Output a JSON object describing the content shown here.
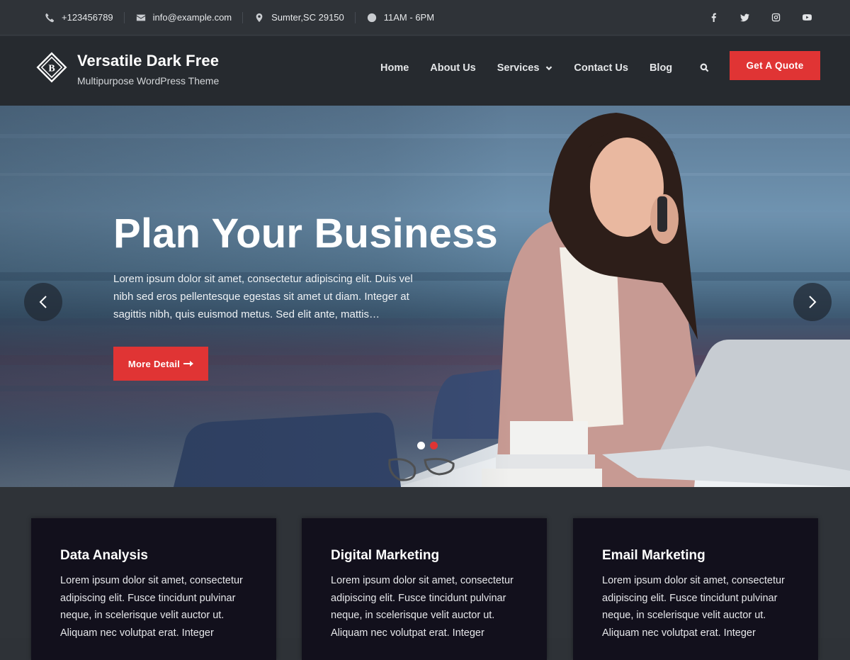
{
  "topbar": {
    "contacts": [
      {
        "icon": "phone-icon",
        "text": "+123456789"
      },
      {
        "icon": "envelope-icon",
        "text": "info@example.com"
      },
      {
        "icon": "map-pin-icon",
        "text": "Sumter,SC 29150"
      },
      {
        "icon": "clock-icon",
        "text": "11AM - 6PM"
      }
    ],
    "social": [
      "facebook-icon",
      "twitter-icon",
      "instagram-icon",
      "youtube-icon"
    ]
  },
  "header": {
    "logo_letter": "B",
    "site_title": "Versatile Dark Free",
    "tagline": "Multipurpose WordPress Theme",
    "nav": [
      "Home",
      "About Us",
      "Services",
      "Contact Us",
      "Blog"
    ],
    "quote_button": "Get A Quote"
  },
  "hero": {
    "title": "Plan Your Business",
    "text": "Lorem ipsum dolor sit amet, consectetur adipiscing elit. Duis vel nibh sed eros pellentesque egestas sit amet ut diam. Integer at sagittis nibh, quis euismod metus. Sed elit ante, mattis…",
    "button": "More Detail",
    "slides": 2,
    "active_slide": 1
  },
  "services": [
    {
      "title": "Data Analysis",
      "text": "Lorem ipsum dolor sit amet, consectetur adipiscing elit. Fusce tincidunt pulvinar neque, in scelerisque velit auctor ut. Aliquam nec volutpat erat. Integer"
    },
    {
      "title": "Digital Marketing",
      "text": "Lorem ipsum dolor sit amet, consectetur adipiscing elit. Fusce tincidunt pulvinar neque, in scelerisque velit auctor ut. Aliquam nec volutpat erat. Integer"
    },
    {
      "title": "Email Marketing",
      "text": "Lorem ipsum dolor sit amet, consectetur adipiscing elit. Fusce tincidunt pulvinar neque, in scelerisque velit auctor ut. Aliquam nec volutpat erat. Integer"
    }
  ],
  "colors": {
    "accent": "#e03434",
    "dot_active": "#ffffff",
    "dot_inactive": "#e03434",
    "card_bg": "#12101c"
  }
}
